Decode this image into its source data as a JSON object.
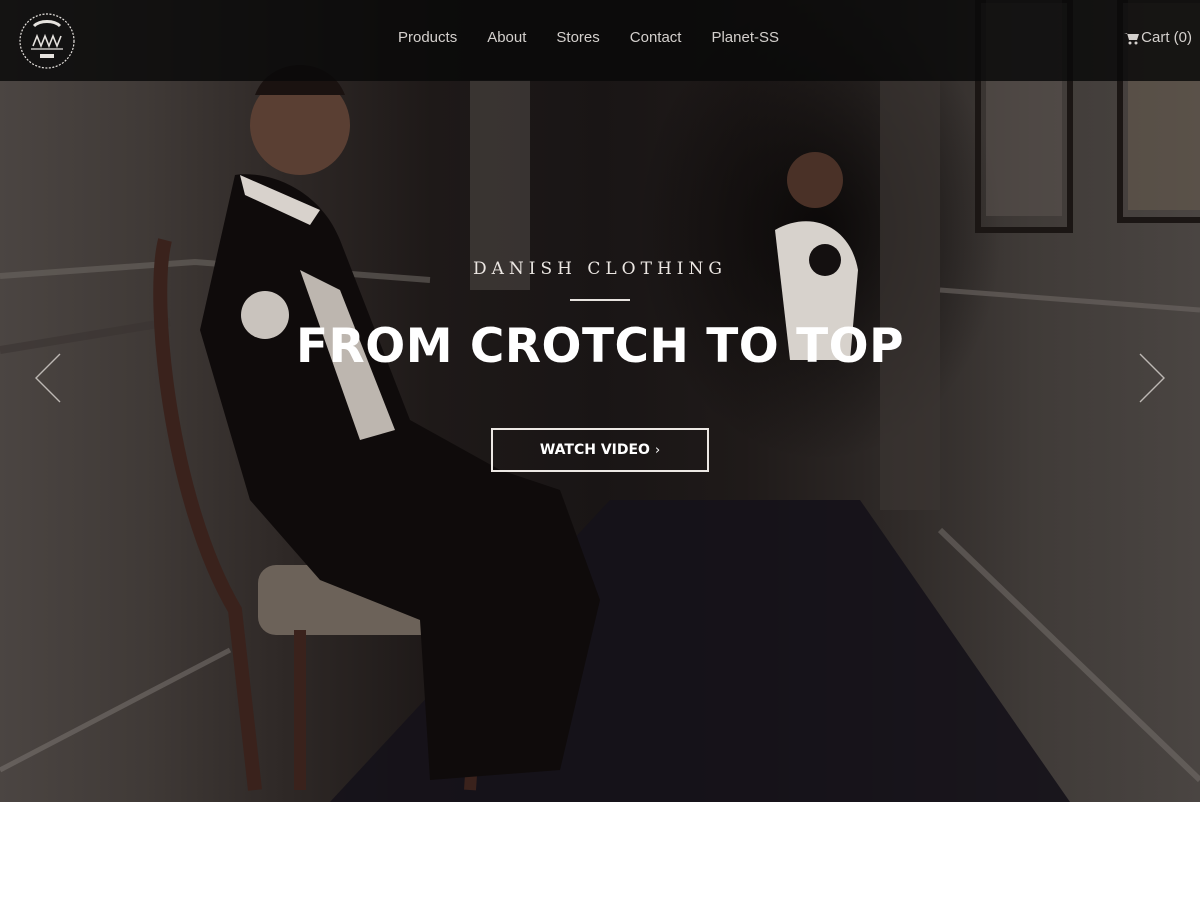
{
  "brand": {
    "logo_alt": "S&S-PROJECTS Est. 2013"
  },
  "nav": {
    "items": [
      {
        "label": "Products"
      },
      {
        "label": "About"
      },
      {
        "label": "Stores"
      },
      {
        "label": "Contact"
      },
      {
        "label": "Planet-SS"
      }
    ],
    "cart_label": "Cart (0)"
  },
  "hero": {
    "eyebrow": "DANISH CLOTHING",
    "headline": "FROM CROTCH TO TOP",
    "cta_label": "WATCH VIDEO",
    "cta_chevron": "›"
  },
  "icons": {
    "logo": "ss-projects-logo",
    "cart": "shopping-cart-icon",
    "prev": "chevron-left-icon",
    "next": "chevron-right-icon"
  },
  "colors": {
    "nav_bg": "#0a0909",
    "nav_text": "#d4d0cd",
    "hero_text": "#ffffff"
  }
}
